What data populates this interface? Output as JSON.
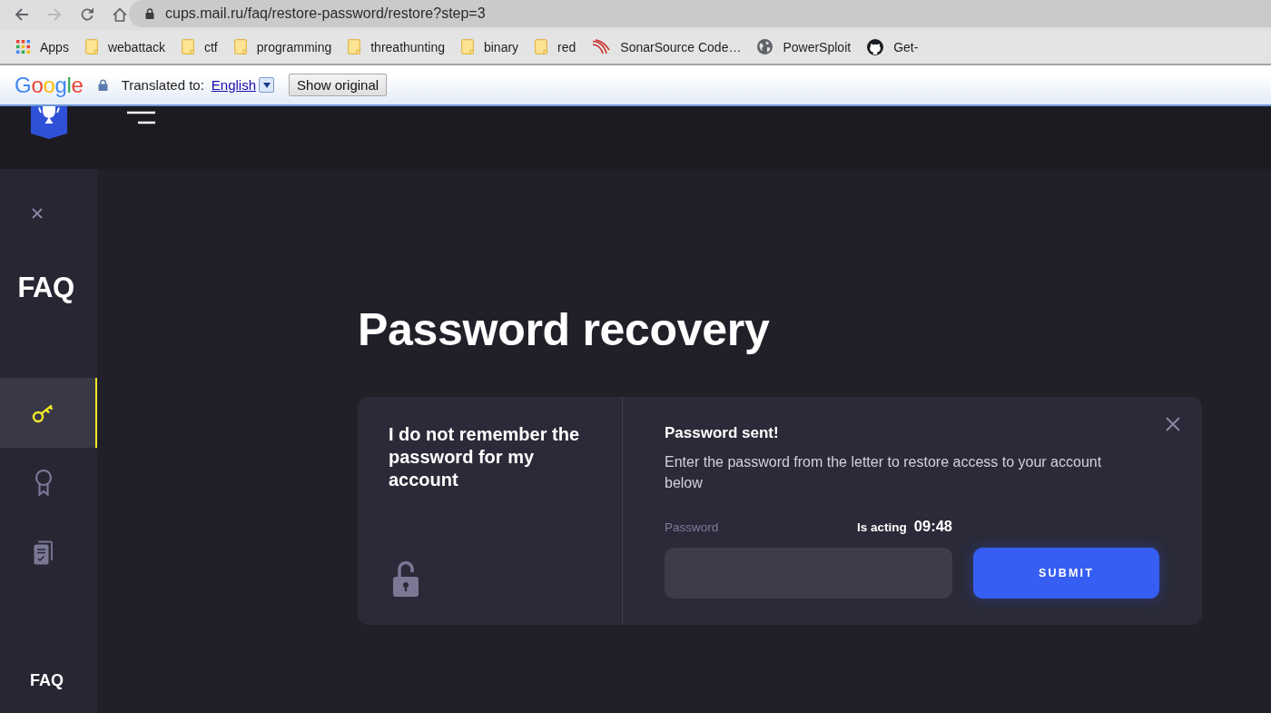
{
  "browser": {
    "nav_buttons": [
      {
        "kind": "back",
        "disabled": false
      },
      {
        "kind": "forward",
        "disabled": true
      },
      {
        "kind": "reload",
        "disabled": false
      },
      {
        "kind": "home",
        "disabled": false
      }
    ],
    "url": "cups.mail.ru/faq/restore-password/restore?step=3",
    "bookmarks": [
      {
        "kind": "apps",
        "label": "Apps"
      },
      {
        "kind": "folder",
        "label": "webattack"
      },
      {
        "kind": "folder",
        "label": "ctf"
      },
      {
        "kind": "folder",
        "label": "programming"
      },
      {
        "kind": "folder",
        "label": "threathunting"
      },
      {
        "kind": "folder",
        "label": "binary"
      },
      {
        "kind": "folder",
        "label": "red"
      },
      {
        "kind": "arcs",
        "label": "SonarSource Code…"
      },
      {
        "kind": "globe",
        "label": "PowerSploit"
      },
      {
        "kind": "cat",
        "label": "Get-"
      }
    ]
  },
  "translate_bar": {
    "logo": "Google",
    "label": "Translated to:",
    "language": "English",
    "button": "Show original"
  },
  "sidebar": {
    "title": "FAQ",
    "items": [
      {
        "kind": "key",
        "selected": true
      },
      {
        "kind": "award",
        "selected": false
      },
      {
        "kind": "document",
        "selected": false
      }
    ],
    "footer": "FAQ"
  },
  "page_title": "Password recovery",
  "card": {
    "option": "I do not remember the password for my account",
    "title": "Password sent!",
    "text": "Enter the password from the letter to restore access to your account below",
    "field_label": "Password",
    "timer_label": "Is acting",
    "timer": "09:48",
    "button": "SUBMIT"
  }
}
